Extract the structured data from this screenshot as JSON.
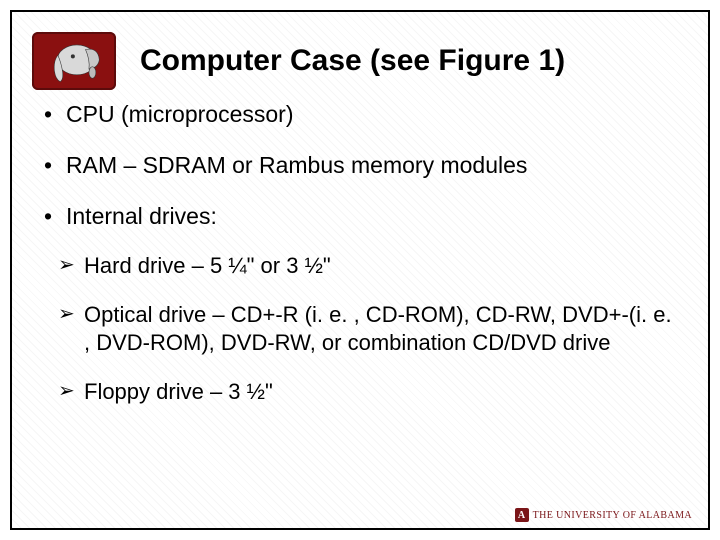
{
  "title": "Computer Case (see Figure 1)",
  "bullets": {
    "b1": "CPU (microprocessor)",
    "b2": "RAM – SDRAM or Rambus memory modules",
    "b3": "Internal drives:"
  },
  "sub": {
    "s1": "Hard drive – 5 ¼\" or 3 ½\"",
    "s2": "Optical drive – CD+-R (i. e. , CD-ROM), CD-RW, DVD+-(i. e. , DVD-ROM), DVD-RW, or combination CD/DVD drive",
    "s3": "Floppy drive – 3 ½\""
  },
  "footer": {
    "mark": "A",
    "text": "THE UNIVERSITY OF ALABAMA"
  }
}
